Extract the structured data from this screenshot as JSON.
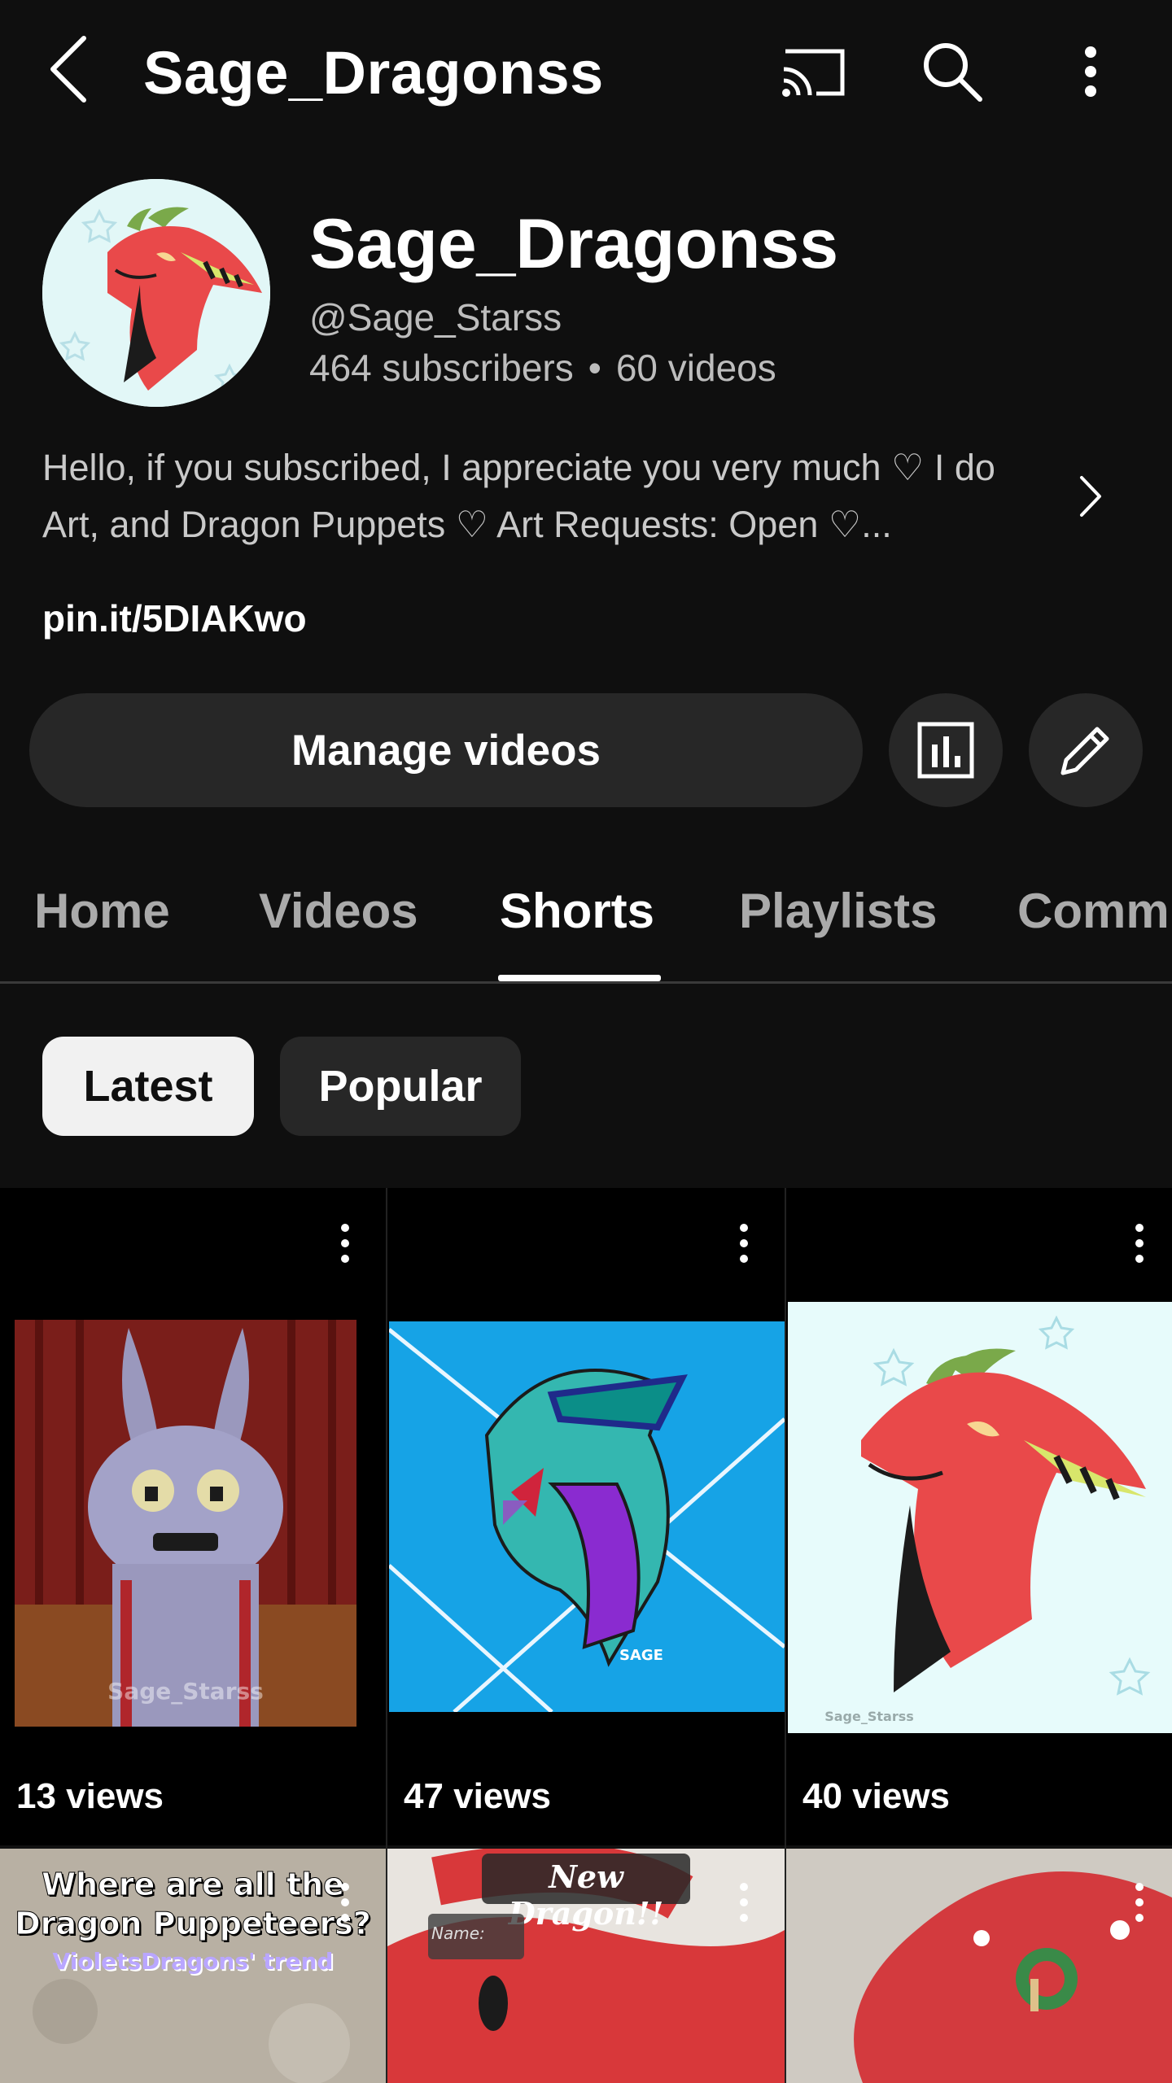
{
  "header": {
    "title": "Sage_Dragonss",
    "icons": [
      "back-arrow-icon",
      "cast-icon",
      "search-icon",
      "more-vert-icon"
    ]
  },
  "channel": {
    "name": "Sage_Dragonss",
    "handle": "@Sage_Starss",
    "subscribers": "464 subscribers",
    "separator": "•",
    "videos": "60 videos",
    "description": "Hello, if you subscribed, I appreciate you very much ♡ I do Art, and Dragon Puppets ♡ Art Requests: Open ♡...",
    "link": "pin.it/5DIAKwo"
  },
  "actions": {
    "manage_label": "Manage videos",
    "analytics_icon": "analytics-icon",
    "edit_icon": "pencil-icon"
  },
  "tabs": [
    {
      "label": "Home",
      "active": false
    },
    {
      "label": "Videos",
      "active": false
    },
    {
      "label": "Shorts",
      "active": true
    },
    {
      "label": "Playlists",
      "active": false
    },
    {
      "label": "Comm",
      "active": false
    }
  ],
  "chips": [
    {
      "label": "Latest",
      "selected": true
    },
    {
      "label": "Popular",
      "selected": false
    }
  ],
  "shorts": [
    {
      "views": "13 views",
      "watermark": "Sage_Starss"
    },
    {
      "views": "47 views",
      "watermark": "SAGE"
    },
    {
      "views": "40 views",
      "watermark": "Sage_Starss"
    },
    {
      "caption_line1": "Where are all the",
      "caption_line2": "Dragon Puppeteers?",
      "caption_line3": "VioletsDragons' trend"
    },
    {
      "caption_title": "New Dragon!!",
      "caption_label": "Name:"
    },
    {}
  ],
  "colors": {
    "background": "#0f0f0f",
    "chip_selected": "#f1f1f1",
    "button_bg": "#272727",
    "muted_text": "#aaaaaa"
  }
}
